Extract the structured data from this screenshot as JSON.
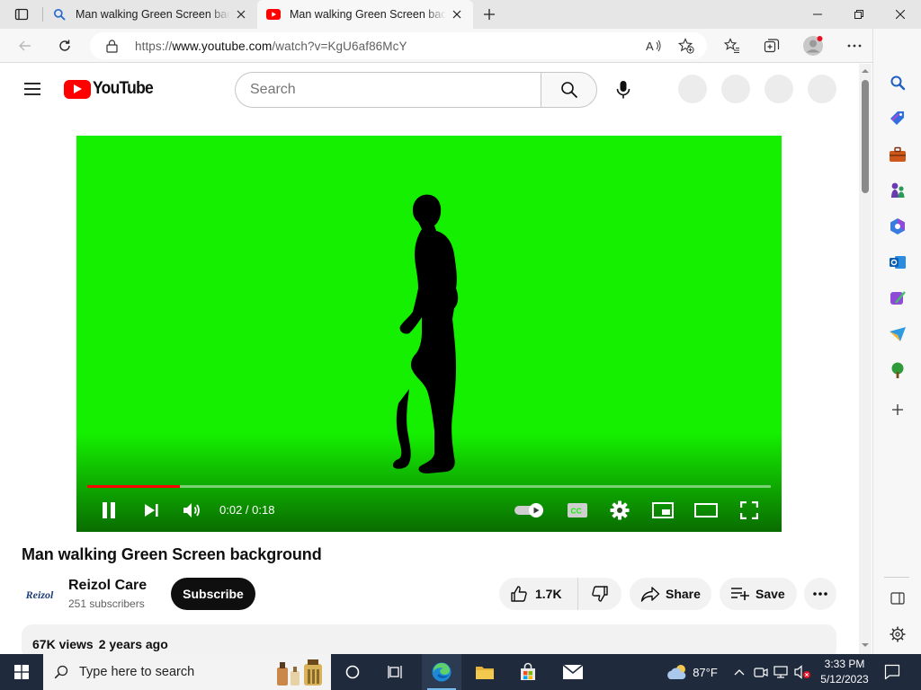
{
  "browser": {
    "tabs": [
      {
        "title": "Man walking Green Screen backg",
        "favicon": "search-icon"
      },
      {
        "title": "Man walking Green Screen backg",
        "favicon": "youtube-icon",
        "active": true
      }
    ],
    "address": {
      "scheme": "https://",
      "host": "www.youtube.com",
      "path": "/watch?v=KgU6af86McY"
    }
  },
  "youtube": {
    "logo_text": "YouTube",
    "search_placeholder": "Search",
    "player": {
      "time_display": "0:02 / 0:18",
      "progress": 0.135,
      "state": "playing"
    },
    "video": {
      "title": "Man walking Green Screen background",
      "channel_name": "Reizol Care",
      "channel_avatar_text": "Reizol",
      "subscribers": "251 subscribers",
      "subscribe_label": "Subscribe",
      "likes": "1.7K",
      "share_label": "Share",
      "save_label": "Save",
      "views": "67K views",
      "age": "2 years ago"
    }
  },
  "taskbar": {
    "search_placeholder": "Type here to search",
    "weather_temp": "87°F",
    "time": "3:33 PM",
    "date": "5/12/2023"
  },
  "colors": {
    "youtube_red": "#ff0000",
    "green_screen": "#14f000",
    "taskbar": "#1f2a3c"
  }
}
